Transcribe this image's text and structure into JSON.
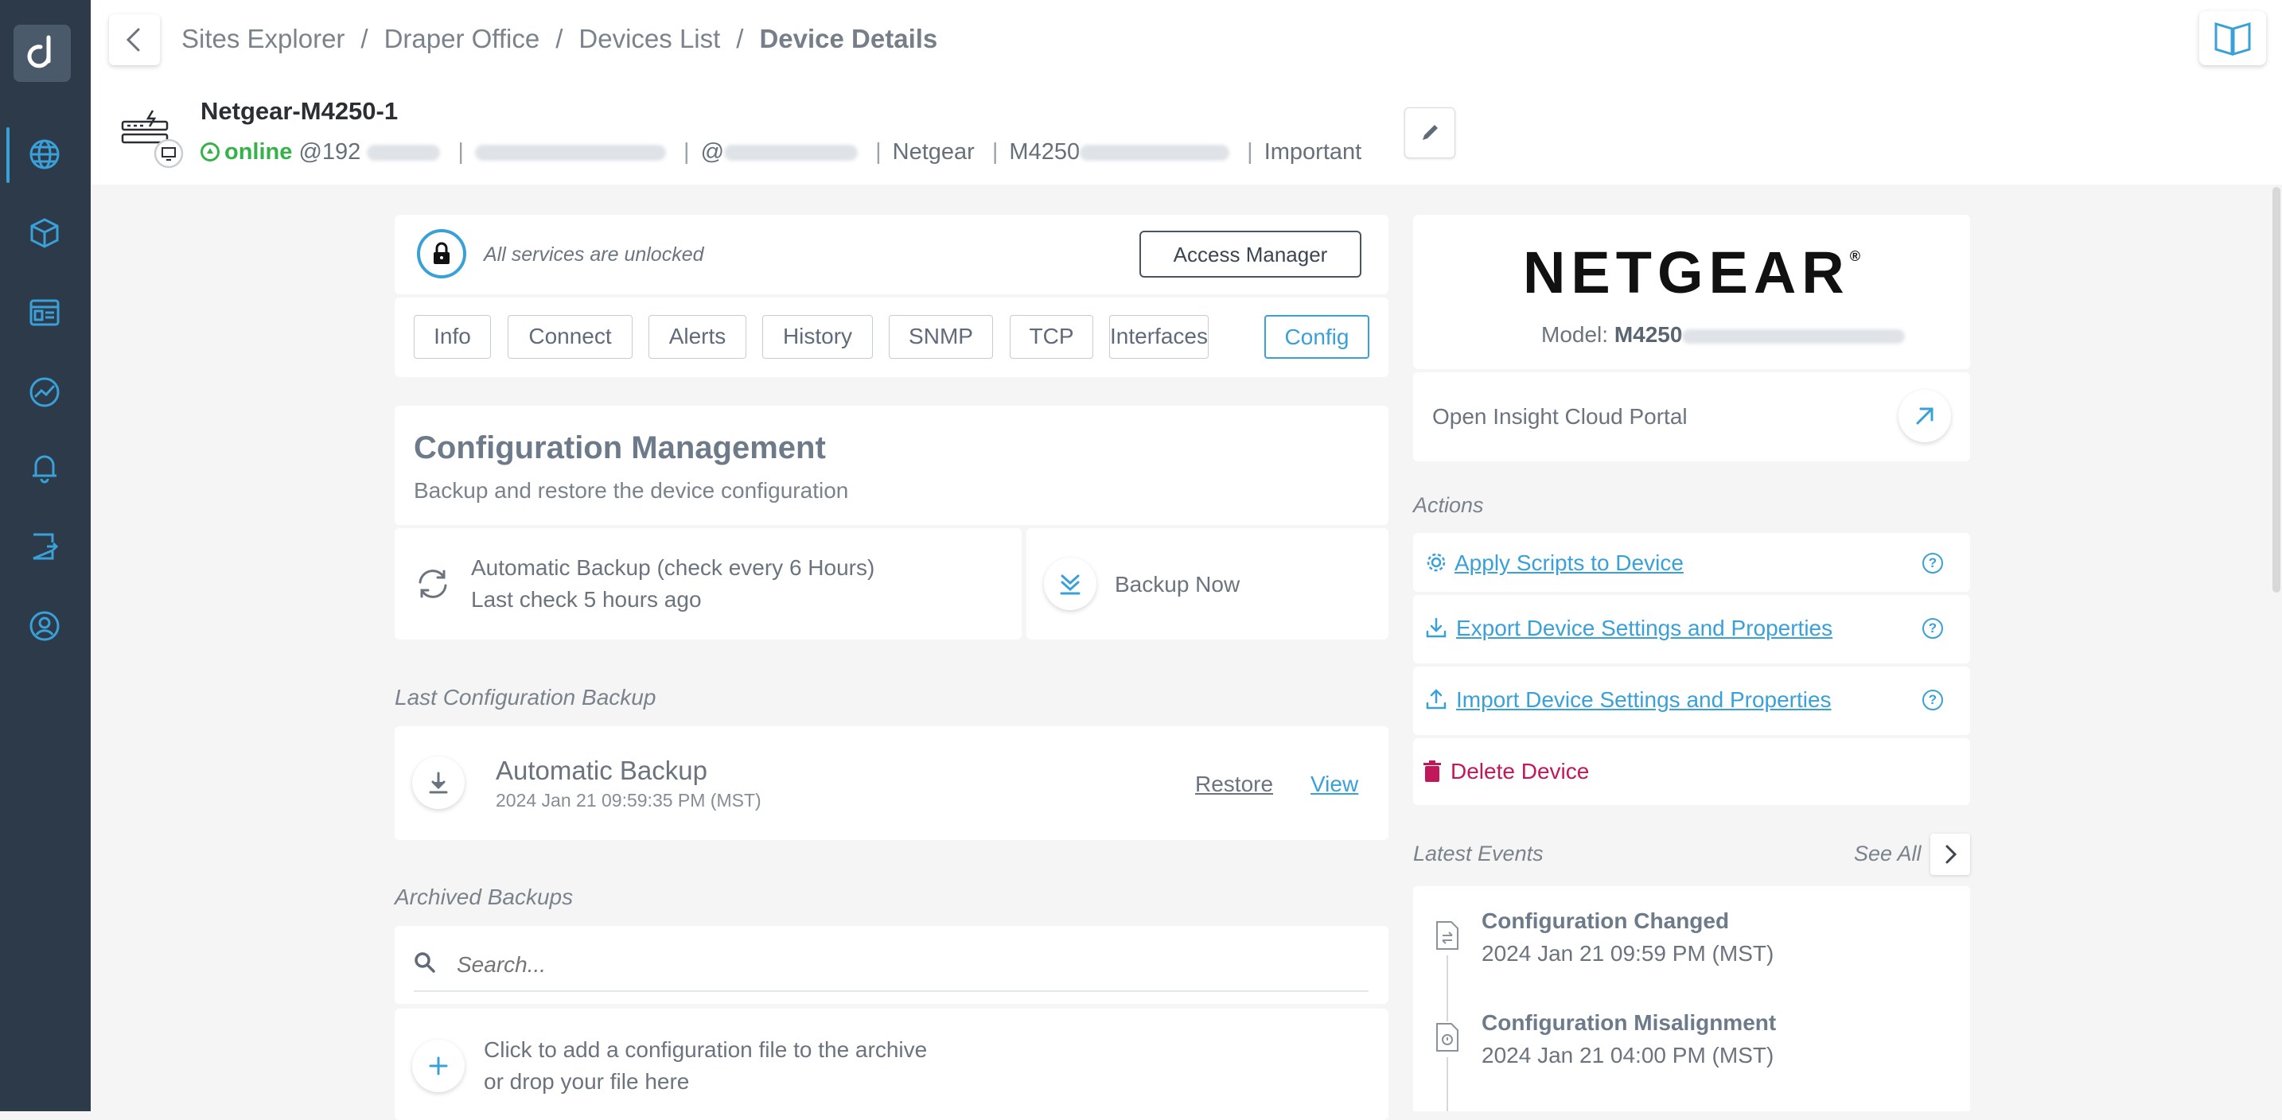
{
  "breadcrumb": {
    "items": [
      "Sites Explorer",
      "Draper Office",
      "Devices List"
    ],
    "current": "Device Details"
  },
  "device": {
    "name": "Netgear-M4250-1",
    "status": "online",
    "ip_prefix": "@192",
    "at_prefix": "@",
    "vendor": "Netgear",
    "model_prefix": "M4250",
    "priority": "Important"
  },
  "lock": {
    "text": "All services are unlocked",
    "button": "Access Manager"
  },
  "tabs": [
    {
      "label": "Info"
    },
    {
      "label": "Connect"
    },
    {
      "label": "Alerts"
    },
    {
      "label": "History"
    },
    {
      "label": "SNMP"
    },
    {
      "label": "TCP"
    },
    {
      "label": "Interfaces"
    },
    {
      "label": "Config"
    }
  ],
  "active_tab": "Config",
  "config": {
    "title": "Configuration Management",
    "subtitle": "Backup and restore the device configuration",
    "auto_backup_line1": "Automatic Backup (check every 6 Hours)",
    "auto_backup_line2": "Last check 5 hours ago",
    "backup_now": "Backup Now"
  },
  "last_backup": {
    "label": "Last Configuration Backup",
    "name": "Automatic Backup",
    "date": "2024 Jan 21 09:59:35 PM (MST)",
    "restore": "Restore",
    "view": "View"
  },
  "archived": {
    "label": "Archived Backups",
    "search_placeholder": "Search...",
    "add_line1": "Click to add a configuration file to the archive",
    "add_line2": "or drop your file here"
  },
  "vendor_panel": {
    "logo_text": "NETGEAR",
    "logo_mark": "®",
    "model_label": "Model:",
    "model_value": "M4250",
    "portal": "Open Insight Cloud Portal"
  },
  "actions": {
    "label": "Actions",
    "apply": "Apply Scripts to Device",
    "export": "Export Device Settings and Properties",
    "import": "Import Device Settings and Properties",
    "delete": "Delete Device",
    "help": "?"
  },
  "events": {
    "label": "Latest Events",
    "see_all": "See All",
    "items": [
      {
        "title": "Configuration Changed",
        "date": "2024 Jan 21 09:59 PM (MST)"
      },
      {
        "title": "Configuration Misalignment",
        "date": "2024 Jan 21 04:00 PM (MST)"
      }
    ]
  },
  "colors": {
    "accent": "#3aa0d8",
    "online": "#35b34a",
    "danger": "#c2185b",
    "sidebar": "#2c3a4a"
  }
}
